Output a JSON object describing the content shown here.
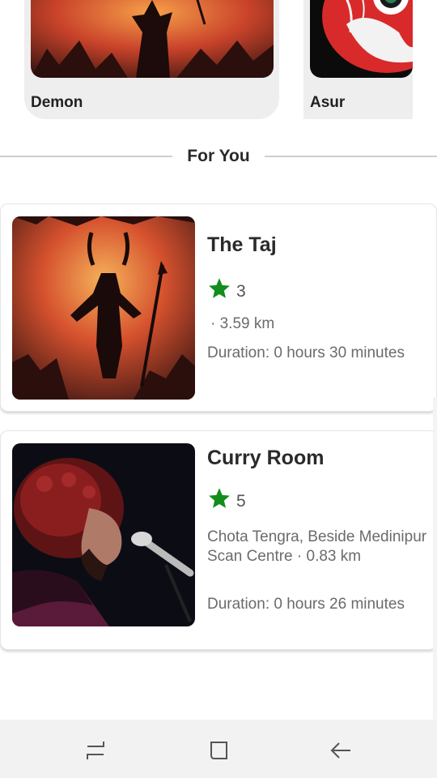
{
  "categories": [
    {
      "label": "Demon"
    },
    {
      "label": "Asur"
    }
  ],
  "section": {
    "title": "For You"
  },
  "places": [
    {
      "name": "The Taj",
      "rating": "3",
      "address": "· 3.59 km",
      "duration": "Duration: 0 hours 30 minutes"
    },
    {
      "name": "Curry Room",
      "rating": "5",
      "address": "Chota Tengra, Beside Medinipur Scan Centre · 0.83 km",
      "duration": "Duration: 0 hours 26 minutes"
    }
  ],
  "icons": {
    "star": "star-icon",
    "nav": [
      "recent-apps-icon",
      "home-icon",
      "back-icon"
    ]
  },
  "colors": {
    "star": "#138d1c",
    "card_bg": "#eeeeee",
    "nav_bg": "#f2f2f2"
  }
}
